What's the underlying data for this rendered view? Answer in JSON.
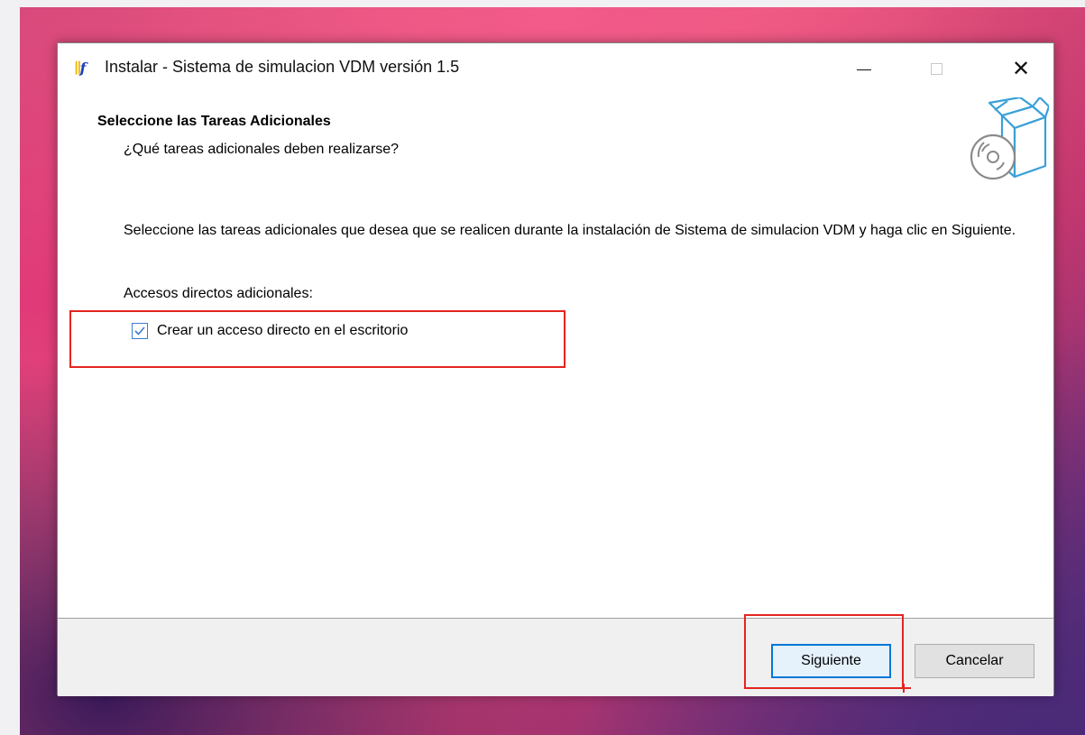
{
  "window": {
    "title": "Instalar - Sistema de simulacion VDM versión 1.5",
    "app_icon_text": "∥f"
  },
  "header": {
    "title": "Seleccione las Tareas Adicionales",
    "subtitle": "¿Qué tareas adicionales deben realizarse?"
  },
  "body": {
    "description": "Seleccione las tareas adicionales que desea que se realicen durante la instalación de Sistema de simulacion VDM y haga clic en Siguiente.",
    "group_label": "Accesos directos adicionales:",
    "checkbox": {
      "label": "Crear un acceso directo en el escritorio",
      "checked": true
    }
  },
  "buttons": {
    "next_label": "Siguiente",
    "cancel_label": "Cancelar"
  },
  "icons": {
    "app": "installer-app-icon",
    "header": "box-disc-icon",
    "minimize": "minimize-icon",
    "maximize": "maximize-icon",
    "close": "close-icon",
    "check": "checkmark-icon"
  },
  "colors": {
    "highlight": "#e5241f",
    "accent": "#0078d7",
    "checkbox_border": "#3b7bd4",
    "icon_blue": "#3aa0d8"
  }
}
